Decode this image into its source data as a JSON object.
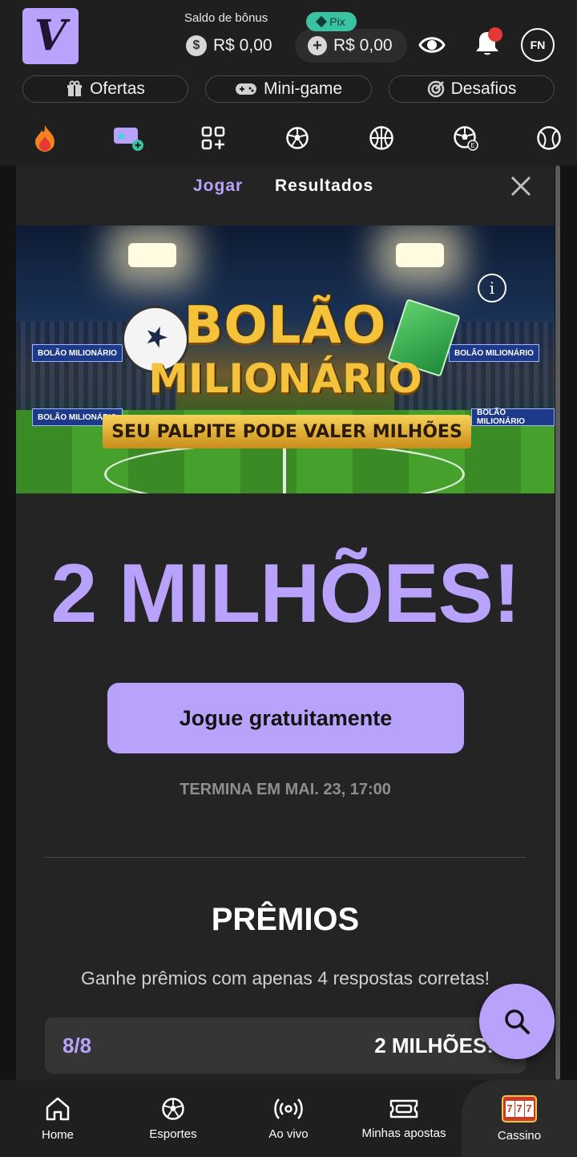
{
  "header": {
    "logo_letter": "V",
    "bonus_label": "Saldo de bônus",
    "bonus_value": "R$ 0,00",
    "coin_symbol": "$",
    "pix_label": "Pix",
    "pix_value": "R$ 0,00",
    "avatar_initials": "FN"
  },
  "pills": [
    {
      "label": "Ofertas",
      "icon": "gift-icon"
    },
    {
      "label": "Mini-game",
      "icon": "gamepad-icon"
    },
    {
      "label": "Desafios",
      "icon": "target-icon"
    }
  ],
  "categories": [
    "fire-icon",
    "ticket-plus-icon",
    "grid-plus-icon",
    "soccer-ball-icon",
    "basketball-icon",
    "esports-ball-icon",
    "tennis-ball-icon"
  ],
  "tabs": {
    "play": "Jogar",
    "results": "Resultados"
  },
  "banner": {
    "line1": "BOLÃO",
    "line2": "MILIONÁRIO",
    "ribbon": "SEU PALPITE PODE VALER MILHÕES",
    "ad_text": "BOLÃO MILIONÁRIO"
  },
  "prize_headline": "2 MILHÕES!",
  "play_button": "Jogue gratuitamente",
  "ends_at": "TERMINA EM MAI. 23, 17:00",
  "prizes": {
    "title": "PRÊMIOS",
    "subtitle": "Ganhe prêmios com apenas 4 respostas corretas!",
    "rows": [
      {
        "level": "8/8",
        "amount": "2 MILHÕES!"
      }
    ]
  },
  "bottom_nav": [
    {
      "label": "Home",
      "icon": "home-icon"
    },
    {
      "label": "Esportes",
      "icon": "soccer-ball-icon"
    },
    {
      "label": "Ao vivo",
      "icon": "live-icon"
    },
    {
      "label": "Minhas apostas",
      "icon": "ticket-icon"
    },
    {
      "label": "Cassino",
      "icon": "slot-machine-icon"
    }
  ],
  "slot_digits": [
    "7",
    "7",
    "7"
  ],
  "colors": {
    "accent": "#b9a2fb",
    "pix": "#39c3a3",
    "notification": "#e53935",
    "background": "#1f1f1f"
  }
}
